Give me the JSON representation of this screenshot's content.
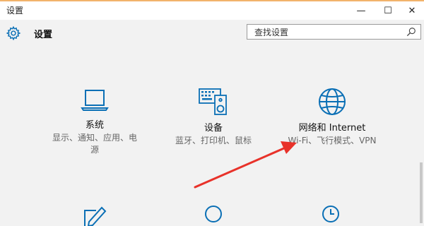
{
  "window": {
    "title": "设置",
    "minimize_glyph": "—",
    "maximize_glyph": "☐",
    "close_glyph": "✕"
  },
  "header": {
    "title": "设置",
    "icon": "gear-icon",
    "search_placeholder": "查找设置",
    "search_icon": "search-icon"
  },
  "tiles": [
    {
      "name": "系统",
      "desc_line1": "显示、通知、应用、电",
      "desc_line2": "源",
      "icon": "laptop-icon"
    },
    {
      "name": "设备",
      "desc_line1": "蓝牙、打印机、鼠标",
      "icon": "keyboard-speaker-icon"
    },
    {
      "name": "网络和 Internet",
      "desc_line1": "Wi-Fi、飞行模式、VPN",
      "icon": "globe-icon"
    },
    {
      "icon": "pen-tablet-icon"
    },
    {
      "icon": "person-icon"
    },
    {
      "icon": "clock-icon"
    }
  ],
  "colors": {
    "accent": "#0a6fb5",
    "annotation_arrow": "#e8322a",
    "background": "#f2f2f2"
  }
}
